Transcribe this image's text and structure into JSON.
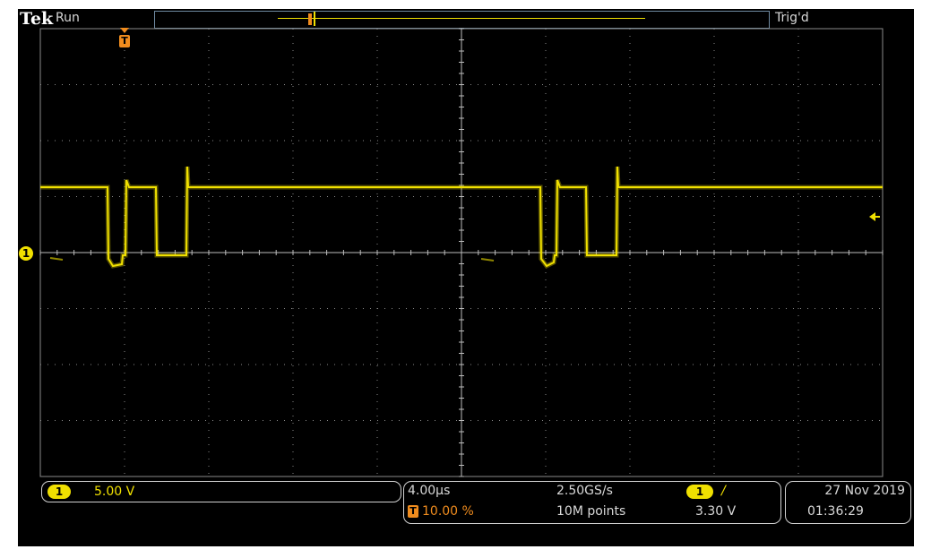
{
  "header": {
    "brand": "Tek",
    "run_status": "Run",
    "trigger_status": "Trig'd",
    "trigger_marker": "T"
  },
  "channel": {
    "number": "1",
    "scale": "5.00 V",
    "color": "#f0e000"
  },
  "timebase": {
    "horizontal_scale": "4.00µs",
    "trigger_position": "10.00 %",
    "sample_rate": "2.50GS/s",
    "record_length": "10M points"
  },
  "trigger": {
    "source": "1",
    "slope_symbol": "/",
    "level": "3.30 V",
    "color": "#f08c1e"
  },
  "clock": {
    "date": "27 Nov 2019",
    "time": "01:36:29"
  },
  "colors": {
    "trace": "#f0e000",
    "grid": "#8a8a8a",
    "trigger": "#f08c1e",
    "background": "#000000"
  }
}
